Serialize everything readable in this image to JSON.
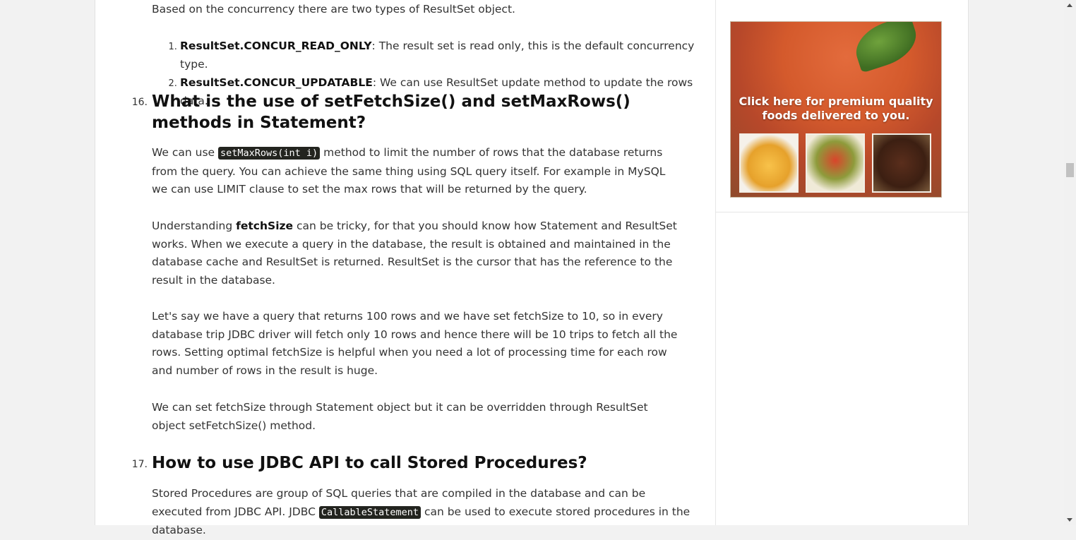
{
  "intro": "Based on the concurrency there are two types of ResultSet object.",
  "concur_items": [
    {
      "name": "ResultSet.CONCUR_READ_ONLY",
      "desc": ": The result set is read only, this is the default concurrency type."
    },
    {
      "name": "ResultSet.CONCUR_UPDATABLE",
      "desc": ": We can use ResultSet update method to update the rows data."
    }
  ],
  "q16": {
    "number": "16.",
    "title": "What is the use of setFetchSize() and setMaxRows() methods in Statement?",
    "p1_pre": "We can use ",
    "p1_code": "setMaxRows(int i)",
    "p1_post": " method to limit the number of rows that the database returns from the query. You can achieve the same thing using SQL query itself. For example in MySQL we can use LIMIT clause to set the max rows that will be returned by the query.",
    "p2_pre": "Understanding ",
    "p2_bold": "fetchSize",
    "p2_post": " can be tricky, for that you should know how Statement and ResultSet works. When we execute a query in the database, the result is obtained and maintained in the database cache and ResultSet is returned. ResultSet is the cursor that has the reference to the result in the database.",
    "p3": "Let's say we have a query that returns 100 rows and we have set fetchSize to 10, so in every database trip JDBC driver will fetch only 10 rows and hence there will be 10 trips to fetch all the rows. Setting optimal fetchSize is helpful when you need a lot of processing time for each row and number of rows in the result is huge.",
    "p4": "We can set fetchSize through Statement object but it can be overridden through ResultSet object setFetchSize() method."
  },
  "q17": {
    "number": "17.",
    "title": "How to use JDBC API to call Stored Procedures?",
    "p1_pre": "Stored Procedures are group of SQL queries that are compiled in the database and can be executed from JDBC API. JDBC ",
    "p1_code": "CallableStatement",
    "p1_post": " can be used to execute stored procedures in the database."
  },
  "ad": {
    "text": "Click here for premium quality foods delivered to you."
  }
}
